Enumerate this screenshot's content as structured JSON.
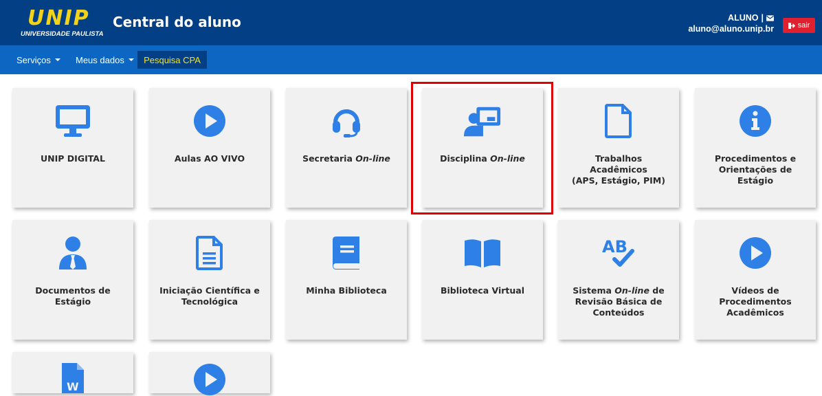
{
  "header": {
    "logo_text": "UNIP",
    "logo_subtitle": "UNIVERSIDADE PAULISTA",
    "title": "Central do aluno",
    "user_name": "ALUNO",
    "separator": "|",
    "user_email": "aluno@aluno.unip.br",
    "logout_label": "sair",
    "colors": {
      "header_bg": "#033f84",
      "nav_bg": "#0d66c2",
      "logo": "#f2d21a",
      "logout": "#e0202f",
      "icon": "#2f80e6"
    }
  },
  "nav": {
    "items": [
      {
        "label": "Serviços"
      },
      {
        "label": "Meus dados"
      }
    ],
    "cpa_label": "Pesquisa CPA"
  },
  "tiles": [
    {
      "label": "UNIP DIGITAL",
      "icon": "monitor-icon"
    },
    {
      "label": "Aulas AO VIVO",
      "icon": "play-icon"
    },
    {
      "label_prefix": "Secretaria ",
      "label_italic": "On-line",
      "icon": "headset-icon"
    },
    {
      "label_prefix": "Disciplina ",
      "label_italic": "On-line",
      "icon": "teacher-board-icon"
    },
    {
      "line1": "Trabalhos",
      "line2": "Acadêmicos",
      "line3": "(APS, Estágio, PIM)",
      "icon": "file-icon"
    },
    {
      "line1": "Procedimentos e",
      "line2": "Orientações de",
      "line3": "Estágio",
      "icon": "info-icon"
    },
    {
      "line1": "Documentos de",
      "line2": "Estágio",
      "icon": "user-tie-icon"
    },
    {
      "line1": "Iniciação Científica e",
      "line2": "Tecnológica",
      "icon": "document-icon"
    },
    {
      "label": "Minha Biblioteca",
      "icon": "book-icon"
    },
    {
      "label": "Biblioteca Virtual",
      "icon": "open-book-icon"
    },
    {
      "line1_prefix": "Sistema ",
      "line1_italic": "On-line",
      "line1_suffix": " de",
      "line2": "Revisão Básica de",
      "line3": "Conteúdos",
      "icon": "spellcheck-icon"
    },
    {
      "line1": "Vídeos de",
      "line2": "Procedimentos",
      "line3": "Acadêmicos",
      "icon": "play-icon"
    },
    {
      "label": "",
      "icon": "word-file-icon"
    },
    {
      "label": "",
      "icon": "play-icon"
    }
  ]
}
